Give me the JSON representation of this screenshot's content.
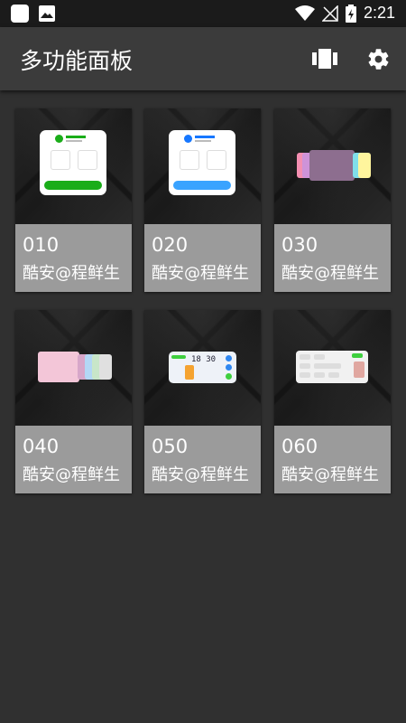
{
  "status_bar": {
    "time": "2:21",
    "icons": [
      "app-notification-icon",
      "image-notification-icon",
      "wifi-icon",
      "no-signal-icon",
      "battery-charging-icon"
    ]
  },
  "app_bar": {
    "title": "多功能面板",
    "actions": [
      "carousel-icon",
      "settings-gear-icon"
    ]
  },
  "colors": {
    "status_bar": "#1b1b1b",
    "app_bar": "#3b3b3b",
    "background": "#303030",
    "card_label_bg": "#9b9b9b",
    "text": "#ffffff",
    "wechat_green": "#1aad19",
    "alipay_blue": "#1677ff"
  },
  "panels": [
    {
      "number": "010",
      "author": "酷安@程鲜生",
      "preview": "wechat-pay-panel"
    },
    {
      "number": "020",
      "author": "酷安@程鲜生",
      "preview": "alipay-panel"
    },
    {
      "number": "030",
      "author": "酷安@程鲜生",
      "preview": "image-card-carousel"
    },
    {
      "number": "040",
      "author": "酷安@程鲜生",
      "preview": "illustration-card-stack"
    },
    {
      "number": "050",
      "author": "酷安@程鲜生",
      "preview": "clock-dashboard-panel"
    },
    {
      "number": "060",
      "author": "酷安@程鲜生",
      "preview": "control-center-panel"
    }
  ],
  "previews": {
    "clock_050": "18 30",
    "wechat_title": "微信支付",
    "alipay_title": "支付宝",
    "alipay_icon_text": "[]"
  }
}
